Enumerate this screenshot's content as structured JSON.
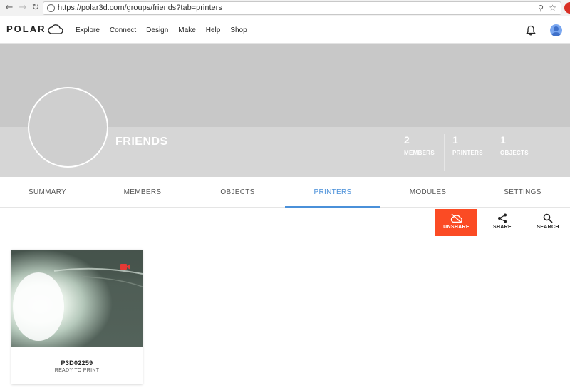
{
  "browser": {
    "url": "https://polar3d.com/groups/friends?tab=printers"
  },
  "header": {
    "logo_text": "POLAR",
    "nav": [
      "Explore",
      "Connect",
      "Design",
      "Make",
      "Help",
      "Shop"
    ]
  },
  "group": {
    "name": "FRIENDS",
    "stats": [
      {
        "count": "2",
        "label": "MEMBERS"
      },
      {
        "count": "1",
        "label": "PRINTERS"
      },
      {
        "count": "1",
        "label": "OBJECTS"
      }
    ]
  },
  "tabs": [
    {
      "label": "SUMMARY",
      "active": false
    },
    {
      "label": "MEMBERS",
      "active": false
    },
    {
      "label": "OBJECTS",
      "active": false
    },
    {
      "label": "PRINTERS",
      "active": true
    },
    {
      "label": "MODULES",
      "active": false
    },
    {
      "label": "SETTINGS",
      "active": false
    }
  ],
  "actions": {
    "unshare": "UNSHARE",
    "share": "SHARE",
    "search": "SEARCH"
  },
  "printers": [
    {
      "name": "P3D02259",
      "status": "READY TO PRINT"
    }
  ],
  "colors": {
    "accent": "#4a90d9",
    "unshare": "#fb4b24",
    "banner": "#c8c8c8"
  }
}
